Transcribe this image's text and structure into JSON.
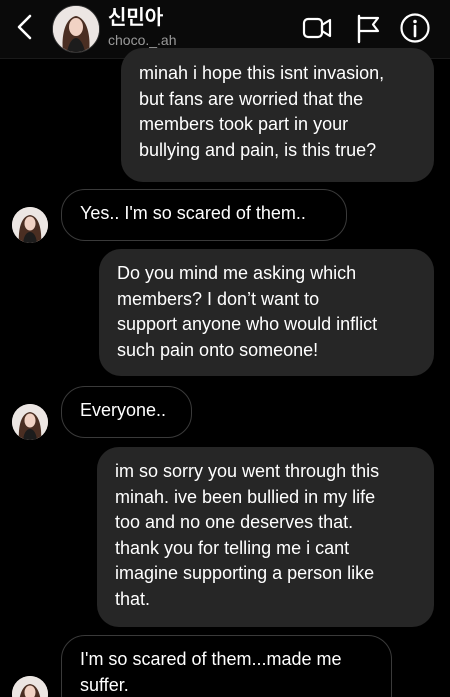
{
  "header": {
    "back_icon": "chevron-left-icon",
    "contact_name": "신민아",
    "contact_handle": "choco._.ah",
    "actions": [
      "video-call-icon",
      "flag-icon",
      "info-icon"
    ]
  },
  "messages": [
    {
      "direction": "sent",
      "lines": [
        "minah i hope this isnt invasion,",
        "but fans are worried that the",
        "members took part in your",
        "bullying and pain, is this true?"
      ]
    },
    {
      "direction": "received",
      "lines": [
        "Yes.. I'm so scared of them.."
      ]
    },
    {
      "direction": "sent",
      "lines": [
        "Do you mind me asking which",
        "members? I don’t want to",
        "support anyone who would inflict",
        "such pain onto someone!"
      ]
    },
    {
      "direction": "received",
      "lines": [
        "Everyone.."
      ]
    },
    {
      "direction": "sent",
      "lines": [
        "im so sorry you went through this",
        "minah. ive been bullied in my life",
        "too and no one deserves that.",
        "thank you for telling me i cant",
        "imagine supporting a person like",
        "that."
      ]
    },
    {
      "direction": "received",
      "lines": [
        "I'm so scared of them...made me",
        "suffer."
      ]
    }
  ],
  "colors": {
    "background": "#000000",
    "sent_bubble": "#262626",
    "received_border": "#3a3a3a",
    "text": "#ffffff",
    "handle_text": "#9a9a9a"
  }
}
